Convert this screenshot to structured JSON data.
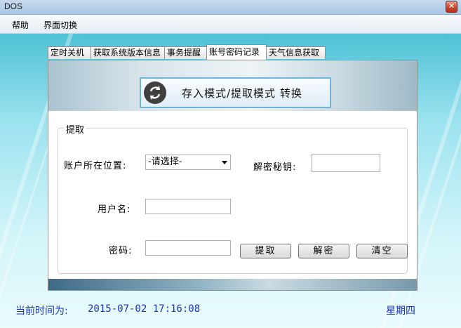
{
  "window": {
    "title": "DOS",
    "close_glyph": "✕"
  },
  "menu": {
    "items": [
      "帮助",
      "界面切换"
    ]
  },
  "tabs": [
    "定时关机",
    "获取系统版本信息",
    "事务提醒",
    "账号密码记录",
    "天气信息获取"
  ],
  "active_tab_index": 3,
  "mode_button": {
    "label": "存入模式/提取模式 转换",
    "icon": "swap-arrows-icon"
  },
  "extract_group": {
    "legend": "提取",
    "account_location_label": "账户所在位置:",
    "account_location_value": "-请选择-",
    "decrypt_key_label": "解密秘钥:",
    "decrypt_key_value": "",
    "username_label": "用户名:",
    "username_value": "",
    "password_label": "密码:",
    "password_value": "",
    "buttons": {
      "extract": "提取",
      "decrypt": "解密",
      "clear": "清空"
    }
  },
  "status": {
    "time_label": "当前时间为:",
    "datetime": "2015-07-02 17:16:08",
    "weekday": "星期四"
  },
  "colors": {
    "status_text": "#1b35b8",
    "close_button": "#c7462c",
    "mode_border": "#6fb4d6"
  }
}
